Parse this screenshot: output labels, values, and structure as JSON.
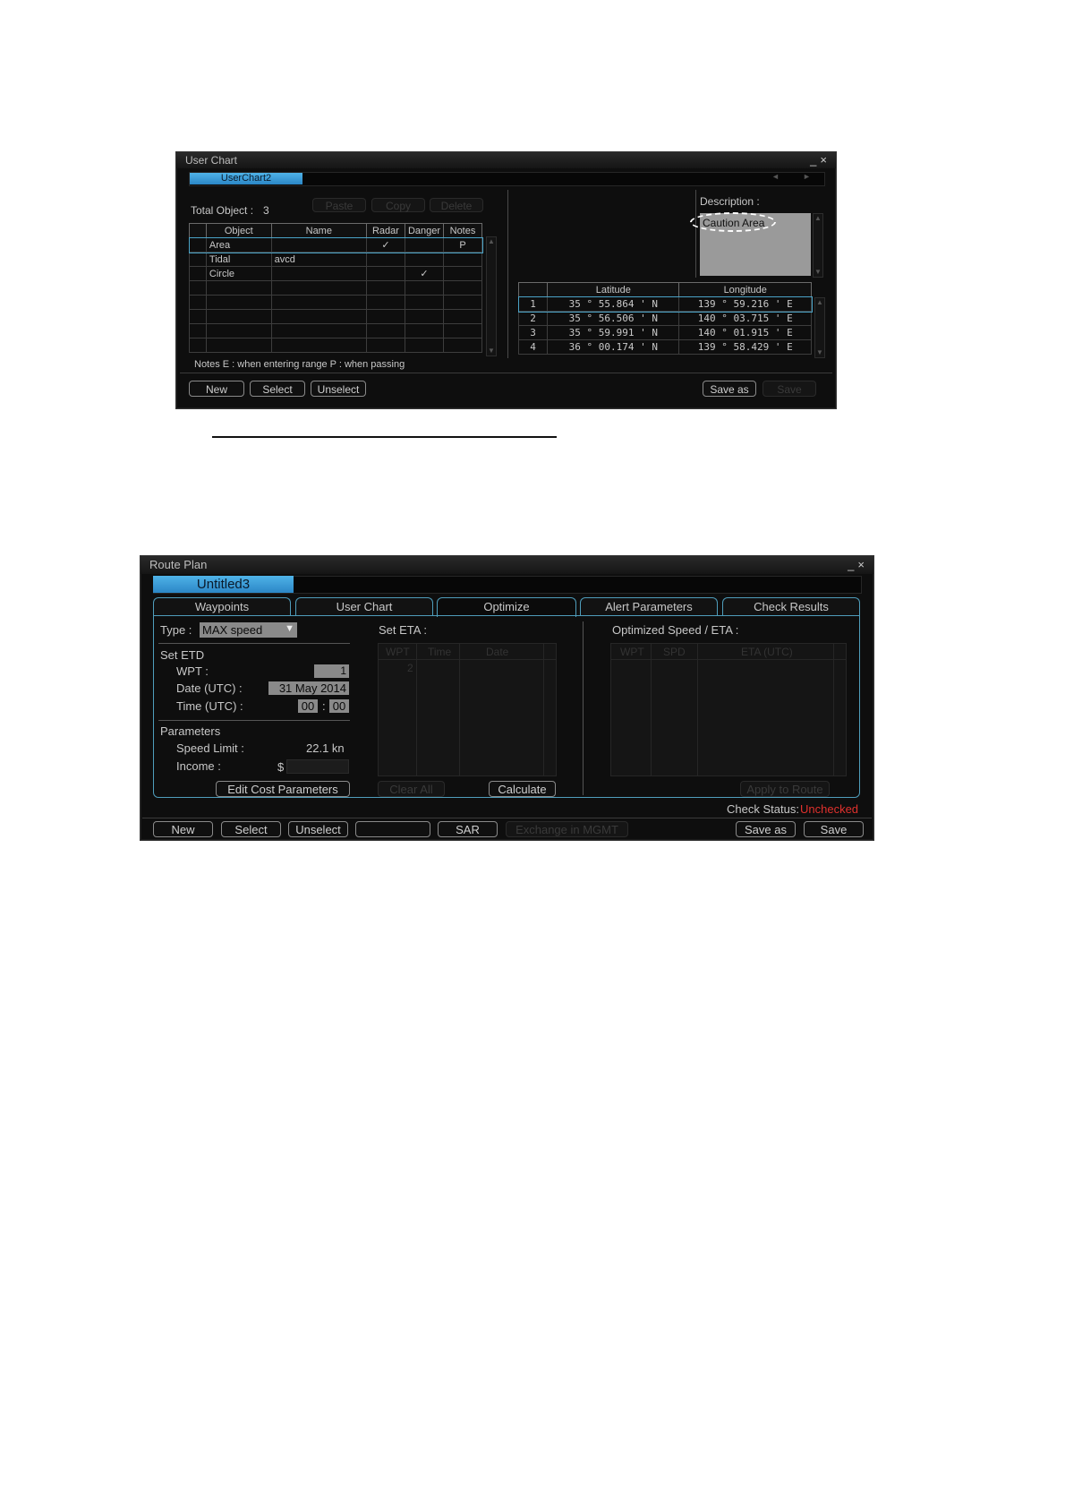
{
  "user_chart": {
    "window_title": "User Chart",
    "window_controls": "_×",
    "tab_label": "UserChart2",
    "total_object_label": "Total Object :",
    "total_object_value": "3",
    "paste_label": "Paste",
    "copy_label": "Copy",
    "delete_label": "Delete",
    "headers": [
      "Object",
      "Name",
      "Radar",
      "Danger",
      "Notes"
    ],
    "rows": [
      {
        "object": "Area",
        "name": "",
        "radar": "✓",
        "danger": "",
        "notes": "P"
      },
      {
        "object": "Tidal",
        "name": "avcd",
        "radar": "",
        "danger": "",
        "notes": ""
      },
      {
        "object": "Circle",
        "name": "",
        "radar": "",
        "danger": "✓",
        "notes": ""
      }
    ],
    "notes_line": "Notes  E : when entering range  P : when passing",
    "description_label": "Description :",
    "description_value": "Caution Area",
    "coord_headers": [
      "Latitude",
      "Longitude"
    ],
    "coords": [
      {
        "n": "1",
        "lat": "35 ° 55.864 ' N",
        "lon": "139 ° 59.216 ' E"
      },
      {
        "n": "2",
        "lat": "35 ° 56.506 ' N",
        "lon": "140 ° 03.715 ' E"
      },
      {
        "n": "3",
        "lat": "35 ° 59.991 ' N",
        "lon": "140 ° 01.915 ' E"
      },
      {
        "n": "4",
        "lat": "36 ° 00.174 ' N",
        "lon": "139 ° 58.429 ' E"
      }
    ],
    "new_label": "New",
    "select_label": "Select",
    "unselect_label": "Unselect",
    "save_as_label": "Save as",
    "save_label": "Save"
  },
  "route_plan": {
    "window_title": "Route Plan",
    "window_controls": "_×",
    "tab_label": "Untitled3",
    "tabs": [
      "Waypoints",
      "User Chart",
      "Optimize",
      "Alert Parameters",
      "Check Results"
    ],
    "type_label": "Type :",
    "type_value": "MAX speed",
    "set_etd_label": "Set ETD",
    "wpt_label": "WPT :",
    "wpt_value": "1",
    "date_label": "Date (UTC) :",
    "date_value": "31 May 2014",
    "time_label": "Time (UTC) :",
    "time_hh": "00",
    "time_sep": ":",
    "time_mm": "00",
    "parameters_label": "Parameters",
    "speed_limit_label": "Speed Limit :",
    "speed_limit_value": "22.1 kn",
    "income_label": "Income :",
    "income_currency": "$",
    "edit_cost_label": "Edit Cost Parameters",
    "set_eta_label": "Set ETA :",
    "eta_headers": [
      "WPT",
      "Time",
      "Date"
    ],
    "eta_first_wpt": "2",
    "clear_all_label": "Clear All",
    "calculate_label": "Calculate",
    "optimized_label": "Optimized Speed / ETA :",
    "opt_headers": [
      "WPT",
      "SPD",
      "ETA (UTC)"
    ],
    "apply_label": "Apply to Route",
    "check_status_label": "Check Status:",
    "check_status_value": "Unchecked",
    "check_status_color": "#e0312d",
    "new_label": "New",
    "select_label": "Select",
    "unselect_label": "Unselect",
    "sar_label": "SAR",
    "exchange_label": "Exchange in MGMT",
    "save_as_label": "Save as",
    "save_label": "Save"
  }
}
